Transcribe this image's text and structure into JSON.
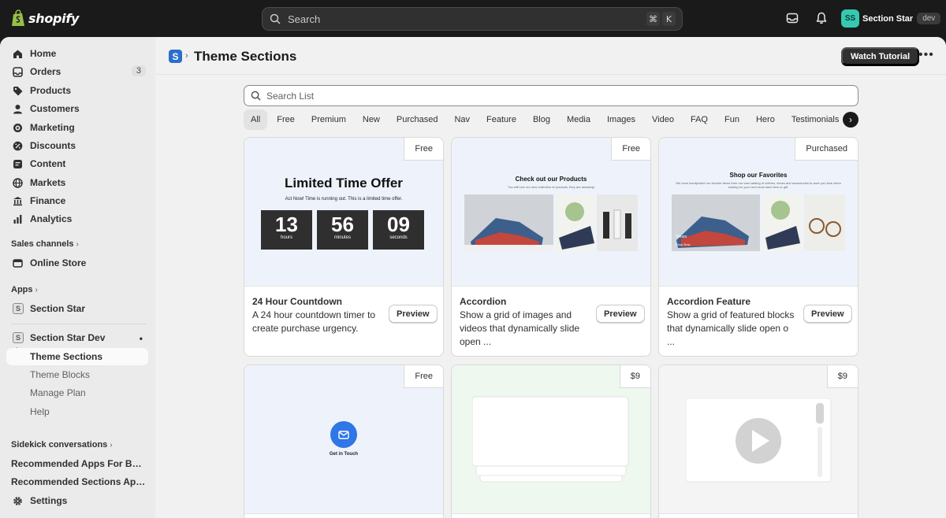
{
  "topbar": {
    "logo_text": "shopify",
    "search_placeholder": "Search",
    "shortcut_mod": "⌘",
    "shortcut_key": "K",
    "store_initials": "SS",
    "store_name": "Section Star",
    "store_badge": "dev"
  },
  "sidebar": {
    "items": [
      {
        "label": "Home",
        "icon": "home-icon"
      },
      {
        "label": "Orders",
        "icon": "orders-icon",
        "count": "3"
      },
      {
        "label": "Products",
        "icon": "tag-icon"
      },
      {
        "label": "Customers",
        "icon": "person-icon"
      },
      {
        "label": "Marketing",
        "icon": "target-icon"
      },
      {
        "label": "Discounts",
        "icon": "discount-icon"
      },
      {
        "label": "Content",
        "icon": "content-icon"
      },
      {
        "label": "Markets",
        "icon": "globe-icon"
      },
      {
        "label": "Finance",
        "icon": "bank-icon"
      },
      {
        "label": "Analytics",
        "icon": "chart-icon"
      }
    ],
    "sales_channels_heading": "Sales channels",
    "online_store": "Online Store",
    "apps_heading": "Apps",
    "app_section_star": "Section Star",
    "app_section_star_dev": "Section Star Dev",
    "app_sub_items": [
      "Theme Sections",
      "Theme Blocks",
      "Manage Plan",
      "Help"
    ],
    "sidekick_heading": "Sidekick conversations",
    "recommended_1": "Recommended Apps For Building a Store",
    "recommended_2": "Recommended Sections Apps for Shopify",
    "settings": "Settings"
  },
  "header": {
    "title": "Theme Sections",
    "watch_tutorial": "Watch Tutorial"
  },
  "list": {
    "search_placeholder": "Search List",
    "filters": [
      "All",
      "Free",
      "Premium",
      "New",
      "Purchased",
      "Nav",
      "Feature",
      "Blog",
      "Media",
      "Images",
      "Video",
      "FAQ",
      "Fun",
      "Hero",
      "Testimonials"
    ],
    "active_filter": "All",
    "preview_label": "Preview",
    "cards": [
      {
        "tag": "Free",
        "name": "24 Hour Countdown",
        "desc": "A 24 hour countdown timer to create purchase urgency."
      },
      {
        "tag": "Free",
        "name": "Accordion",
        "desc": "Show a grid of images and videos that dynamically slide open ..."
      },
      {
        "tag": "Purchased",
        "name": "Accordion Feature",
        "desc": "Show a grid of featured blocks that dynamically slide open o ..."
      },
      {
        "tag": "Free"
      },
      {
        "tag": "$9"
      },
      {
        "tag": "$9"
      }
    ],
    "countdown": {
      "title": "Limited Time Offer",
      "subtitle": "Act Now! Time is running out. This is a limited time offer.",
      "hours": "13",
      "hours_label": "hours",
      "minutes": "56",
      "minutes_label": "minutes",
      "seconds": "09",
      "seconds_label": "seconds"
    },
    "accordion_thumb": {
      "title": "Check out our Products",
      "subtitle": "You will love our new collection of products, they are amazing!"
    },
    "feature_thumb": {
      "title": "Shop our Favorites",
      "subtitle": "We have handpicked our favorite items from our vast catalog of clothes, shoes and accessories to save you time when looking for your next must have item or gift.",
      "label": "Shoes",
      "cta": "Shop Now"
    },
    "contact_thumb": {
      "label": "Get in Touch"
    }
  }
}
